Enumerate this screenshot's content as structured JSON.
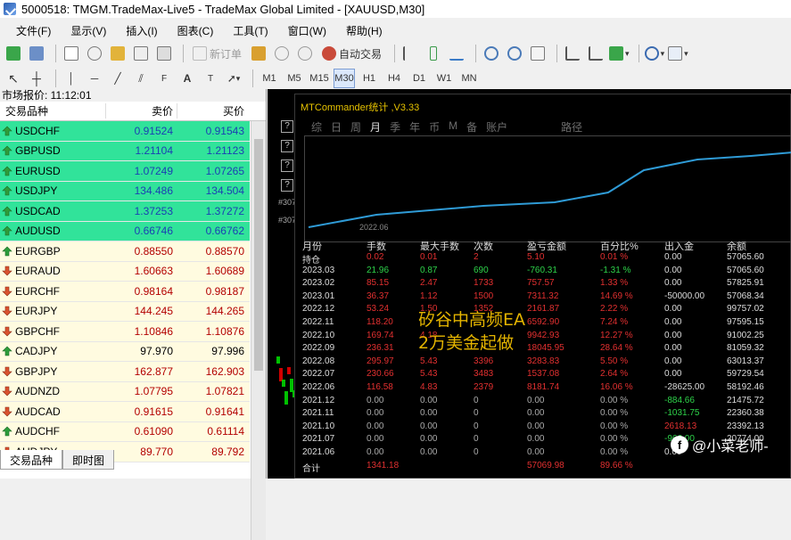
{
  "window": {
    "title": "5000518: TMGM.TradeMax-Live5 - TradeMax Global Limited - [XAUUSD,M30]"
  },
  "menu": [
    "文件(F)",
    "显示(V)",
    "插入(I)",
    "图表(C)",
    "工具(T)",
    "窗口(W)",
    "帮助(H)"
  ],
  "toolbar": {
    "new_order": "新订单",
    "auto_trade": "自动交易"
  },
  "timeframes": [
    "M1",
    "M5",
    "M15",
    "M30",
    "H1",
    "H4",
    "D1",
    "W1",
    "MN"
  ],
  "timeframe_active": "M30",
  "market_watch": {
    "title": "市场报价: 11:12:01",
    "col_symbol": "交易品种",
    "col_bid": "卖价",
    "col_ask": "买价",
    "rows": [
      {
        "symbol": "USDCHF",
        "bid": "0.91524",
        "ask": "0.91543",
        "style": "hl",
        "dir": "up"
      },
      {
        "symbol": "GBPUSD",
        "bid": "1.21104",
        "ask": "1.21123",
        "style": "hl",
        "dir": "up"
      },
      {
        "symbol": "EURUSD",
        "bid": "1.07249",
        "ask": "1.07265",
        "style": "hl",
        "dir": "up"
      },
      {
        "symbol": "USDJPY",
        "bid": "134.486",
        "ask": "134.504",
        "style": "hl",
        "dir": "up"
      },
      {
        "symbol": "USDCAD",
        "bid": "1.37253",
        "ask": "1.37272",
        "style": "hl",
        "dir": "up"
      },
      {
        "symbol": "AUDUSD",
        "bid": "0.66746",
        "ask": "0.66762",
        "style": "hl",
        "dir": "up"
      },
      {
        "symbol": "EURGBP",
        "bid": "0.88550",
        "ask": "0.88570",
        "style": "nh",
        "dir": "up"
      },
      {
        "symbol": "EURAUD",
        "bid": "1.60663",
        "ask": "1.60689",
        "style": "nh",
        "dir": "down"
      },
      {
        "symbol": "EURCHF",
        "bid": "0.98164",
        "ask": "0.98187",
        "style": "nh",
        "dir": "down"
      },
      {
        "symbol": "EURJPY",
        "bid": "144.245",
        "ask": "144.265",
        "style": "nh",
        "dir": "down"
      },
      {
        "symbol": "GBPCHF",
        "bid": "1.10846",
        "ask": "1.10876",
        "style": "nh",
        "dir": "down"
      },
      {
        "symbol": "CADJPY",
        "bid": "97.970",
        "ask": "97.996",
        "style": "blk",
        "dir": "up"
      },
      {
        "symbol": "GBPJPY",
        "bid": "162.877",
        "ask": "162.903",
        "style": "nh",
        "dir": "down"
      },
      {
        "symbol": "AUDNZD",
        "bid": "1.07795",
        "ask": "1.07821",
        "style": "nh",
        "dir": "down"
      },
      {
        "symbol": "AUDCAD",
        "bid": "0.91615",
        "ask": "0.91641",
        "style": "nh",
        "dir": "down"
      },
      {
        "symbol": "AUDCHF",
        "bid": "0.61090",
        "ask": "0.61114",
        "style": "nh",
        "dir": "up"
      },
      {
        "symbol": "AUDJPY",
        "bid": "89.770",
        "ask": "89.792",
        "style": "nh",
        "dir": "down"
      }
    ],
    "tabs": [
      "交易品种",
      "即时图"
    ]
  },
  "chart": {
    "price_labels": [
      "#307",
      "#307"
    ]
  },
  "mtcommander": {
    "title": "MTCommander统计 ,V3.33",
    "tabs": [
      "综",
      "日",
      "周",
      "月",
      "季",
      "年",
      "币",
      "M",
      "备",
      "账户",
      "路径"
    ],
    "active_tab": "月",
    "curve_date": "2022.06",
    "headers": [
      "月份",
      "手数",
      "最大手数",
      "次数",
      "盈亏金额",
      "百分比%",
      "出入金",
      "余额"
    ],
    "rows": [
      {
        "month": "持仓",
        "lots": "0.02",
        "max": "0.01",
        "cnt": "2",
        "pnl": "5.10",
        "pct": "0.01 %",
        "flow": "0.00",
        "bal": "57065.60",
        "cls": "red"
      },
      {
        "month": "2023.03",
        "lots": "21.96",
        "max": "0.87",
        "cnt": "690",
        "pnl": "-760.31",
        "pct": "-1.31 %",
        "flow": "0.00",
        "bal": "57065.60",
        "cls": "green"
      },
      {
        "month": "2023.02",
        "lots": "85.15",
        "max": "2.47",
        "cnt": "1733",
        "pnl": "757.57",
        "pct": "1.33 %",
        "flow": "0.00",
        "bal": "57825.91",
        "cls": "red"
      },
      {
        "month": "2023.01",
        "lots": "36.37",
        "max": "1.12",
        "cnt": "1500",
        "pnl": "7311.32",
        "pct": "14.69 %",
        "flow": "-50000.00",
        "bal": "57068.34",
        "cls": "red"
      },
      {
        "month": "2022.12",
        "lots": "53.24",
        "max": "1.50",
        "cnt": "1352",
        "pnl": "2161.87",
        "pct": "2.22 %",
        "flow": "0.00",
        "bal": "99757.02",
        "cls": "red"
      },
      {
        "month": "2022.11",
        "lots": "118.20",
        "max": "",
        "cnt": "",
        "pnl": "6592.90",
        "pct": "7.24 %",
        "flow": "0.00",
        "bal": "97595.15",
        "cls": "red"
      },
      {
        "month": "2022.10",
        "lots": "169.74",
        "max": "4.18",
        "cnt": "",
        "pnl": "9942.93",
        "pct": "12.27 %",
        "flow": "0.00",
        "bal": "91002.25",
        "cls": "red"
      },
      {
        "month": "2022.09",
        "lots": "236.31",
        "max": "",
        "cnt": "",
        "pnl": "18045.95",
        "pct": "28.64 %",
        "flow": "0.00",
        "bal": "81059.32",
        "cls": "red"
      },
      {
        "month": "2022.08",
        "lots": "295.97",
        "max": "5.43",
        "cnt": "3396",
        "pnl": "3283.83",
        "pct": "5.50 %",
        "flow": "0.00",
        "bal": "63013.37",
        "cls": "red"
      },
      {
        "month": "2022.07",
        "lots": "230.66",
        "max": "5.43",
        "cnt": "3483",
        "pnl": "1537.08",
        "pct": "2.64 %",
        "flow": "0.00",
        "bal": "59729.54",
        "cls": "red"
      },
      {
        "month": "2022.06",
        "lots": "116.58",
        "max": "4.83",
        "cnt": "2379",
        "pnl": "8181.74",
        "pct": "16.06 %",
        "flow": "-28625.00",
        "bal": "58192.46",
        "cls": "red"
      },
      {
        "month": "2021.12",
        "lots": "0.00",
        "max": "0.00",
        "cnt": "0",
        "pnl": "0.00",
        "pct": "0.00 %",
        "flow": "-884.66",
        "bal": "21475.72",
        "cls": "gray",
        "flowcls": "green"
      },
      {
        "month": "2021.11",
        "lots": "0.00",
        "max": "0.00",
        "cnt": "0",
        "pnl": "0.00",
        "pct": "0.00 %",
        "flow": "-1031.75",
        "bal": "22360.38",
        "cls": "gray",
        "flowcls": "green"
      },
      {
        "month": "2021.10",
        "lots": "0.00",
        "max": "0.00",
        "cnt": "0",
        "pnl": "0.00",
        "pct": "0.00 %",
        "flow": "2618.13",
        "bal": "23392.13",
        "cls": "gray",
        "flowcls": "red"
      },
      {
        "month": "2021.07",
        "lots": "0.00",
        "max": "0.00",
        "cnt": "0",
        "pnl": "0.00",
        "pct": "0.00 %",
        "flow": "-966.00",
        "bal": "20774.00",
        "cls": "gray",
        "flowcls": "green"
      },
      {
        "month": "2021.06",
        "lots": "0.00",
        "max": "0.00",
        "cnt": "0",
        "pnl": "0.00",
        "pct": "0.00 %",
        "flow": "0.00",
        "bal": "",
        "cls": "gray"
      }
    ],
    "total": {
      "month": "合计",
      "lots": "1341.18",
      "max": "",
      "cnt": "",
      "pnl": "57069.98",
      "pct": "89.66 %",
      "flow": "",
      "bal": ""
    }
  },
  "overlay": {
    "line1": "矽谷中高频EA",
    "line2": "2万美金起做"
  },
  "watermark": "@小菜老师-"
}
